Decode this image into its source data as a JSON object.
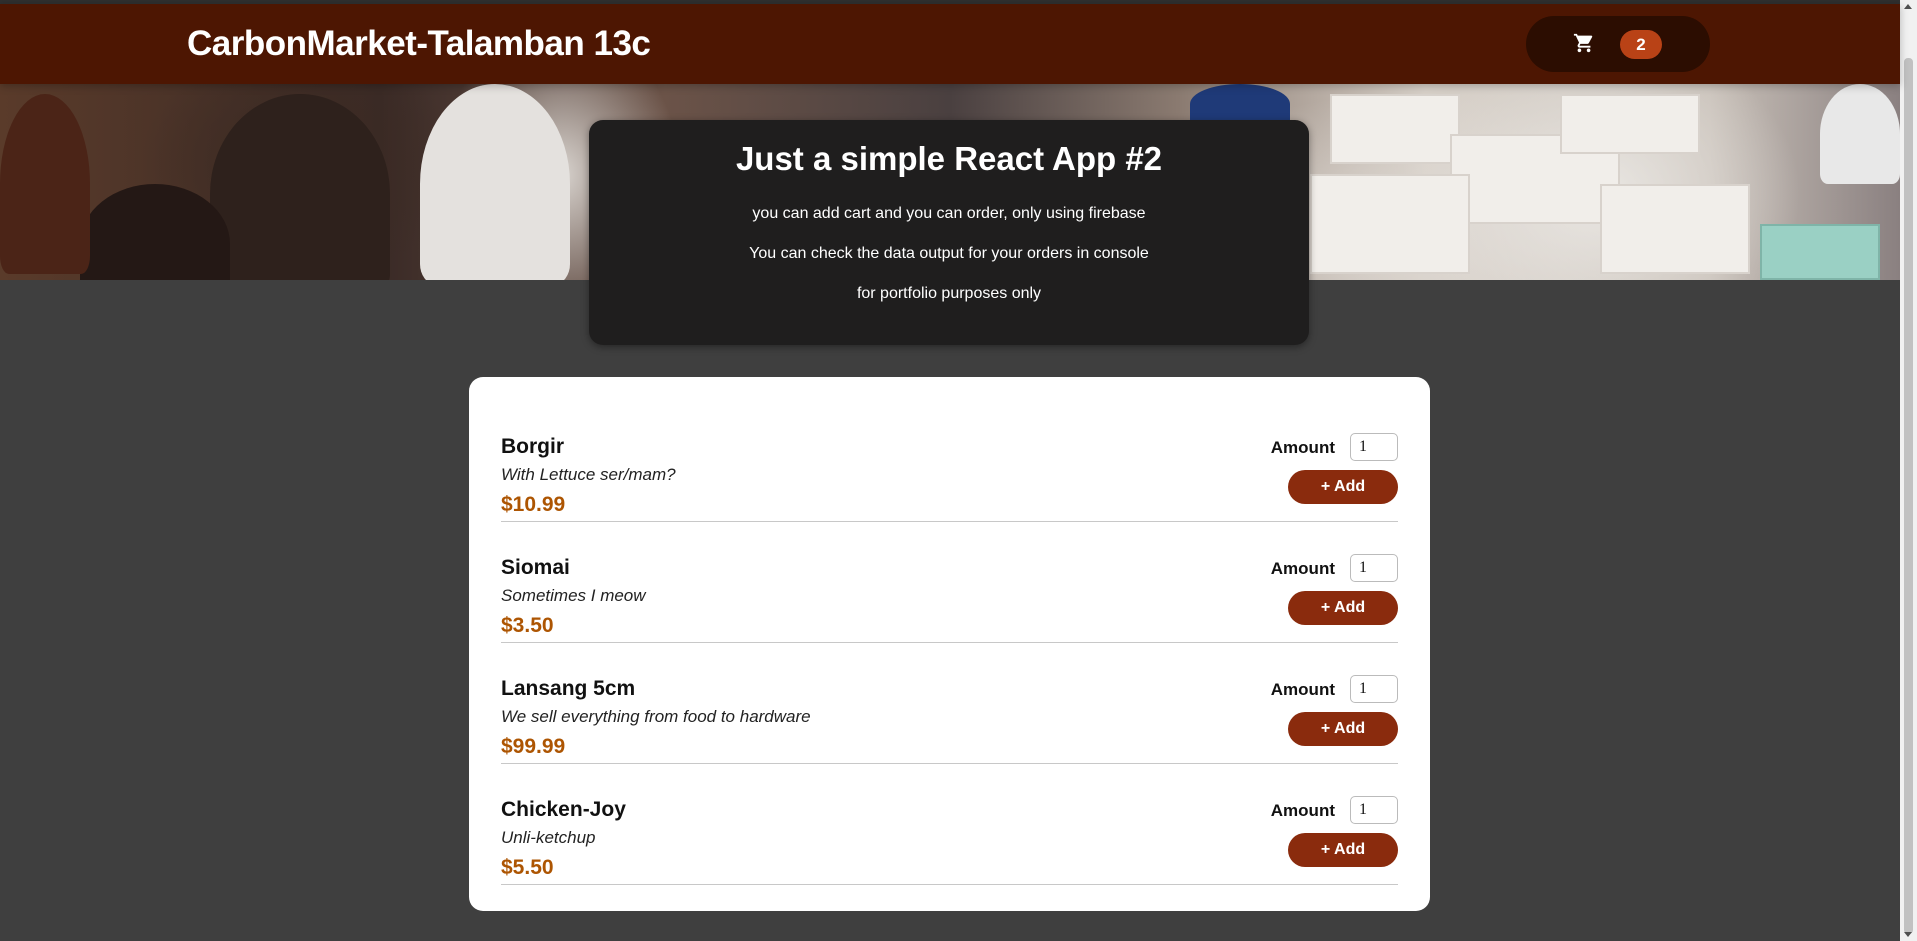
{
  "header": {
    "title": "CarbonMarket-Talamban 13c",
    "cart_icon": "shopping-cart-icon",
    "cart_count": "2"
  },
  "summary": {
    "heading": "Just a simple React App #2",
    "lines": [
      "you can add cart and you can order, only using firebase",
      "You can check the data output for your orders in console",
      "for portfolio purposes only"
    ]
  },
  "meals": [
    {
      "name": "Borgir",
      "description": "With Lettuce ser/mam?",
      "price": "$10.99",
      "amount_label": "Amount",
      "amount": "1",
      "add_label": "+ Add"
    },
    {
      "name": "Siomai",
      "description": "Sometimes I meow",
      "price": "$3.50",
      "amount_label": "Amount",
      "amount": "1",
      "add_label": "+ Add"
    },
    {
      "name": "Lansang 5cm",
      "description": "We sell everything from food to hardware",
      "price": "$99.99",
      "amount_label": "Amount",
      "amount": "1",
      "add_label": "+ Add"
    },
    {
      "name": "Chicken-Joy",
      "description": "Unli-ketchup",
      "price": "$5.50",
      "amount_label": "Amount",
      "amount": "1",
      "add_label": "+ Add"
    }
  ],
  "colors": {
    "header_bg": "#4d1602",
    "cart_button_bg": "#2c0d01",
    "badge_bg": "#b94216",
    "add_button_bg": "#8a2b0d",
    "price": "#ad5502",
    "page_bg": "#3f3f3f"
  }
}
